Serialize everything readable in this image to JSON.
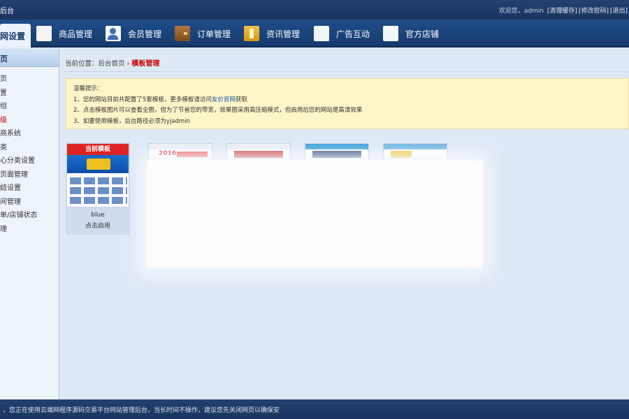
{
  "topbar": {
    "title": "后台",
    "welcome": "欢迎您，admin",
    "links": [
      "[清理缓存]",
      "[修改密码]",
      "[退出]"
    ]
  },
  "nav": {
    "items": [
      {
        "label": "网设置",
        "icon": "none",
        "active": true
      },
      {
        "label": "商品管理",
        "icon": "goods-grid-icon"
      },
      {
        "label": "会员管理",
        "icon": "member-card-icon"
      },
      {
        "label": "订单管理",
        "icon": "wallet-icon"
      },
      {
        "label": "资讯管理",
        "icon": "book-icon"
      },
      {
        "label": "广告互动",
        "icon": "list-icon"
      },
      {
        "label": "官方店铺",
        "icon": "list-icon"
      }
    ]
  },
  "sidebar": {
    "header": "页",
    "items": [
      "页",
      "置",
      "组",
      "级",
      "商系统",
      "类",
      "心分类设置",
      "页面管理",
      "结设置",
      "间管理",
      "单/店铺状态",
      "理"
    ],
    "current_index": 3
  },
  "breadcrumb": {
    "prefix": "当前位置：",
    "home": "后台首页",
    "separator": "›",
    "current": "模板管理"
  },
  "tips": {
    "title": "温馨提示：",
    "line1_pre": "1、您的网站目前共配置了5套模板，更多模板请访问",
    "line1_link": "友价官网",
    "line1_post": "获取",
    "line2": "2、点击模板图片可以查看全图，但为了节省您的带宽，效果图采用高压缩模式，但启用后您的网站是高清效果",
    "line3": "3、如要使用模板，后台路径必须为yjadmin"
  },
  "templates": {
    "current": {
      "ribbon": "当前模板",
      "name": "blue",
      "action": "点击启用"
    },
    "others": [
      {
        "preview_text": "2016"
      }
    ]
  },
  "footer": {
    "text": "，您正在使用云端网程序源码交易平台网站管理后台，当长时间不操作，建议您先关闭网页以确保安"
  },
  "colors": {
    "topbar": "#1b3560",
    "nav": "#1f4d8a",
    "accent_red": "#cc0000",
    "tips_bg": "#fdf5c8",
    "page_bg": "#dfe9f5"
  }
}
